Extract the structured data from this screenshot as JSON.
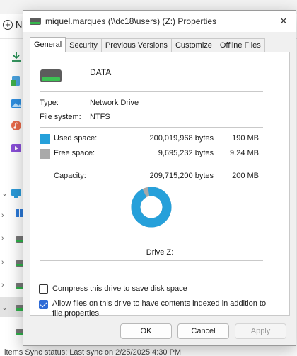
{
  "background": {
    "new_label": "N",
    "status_text": "items     Sync status:  Last sync on 2/25/2025 4:30 PM"
  },
  "dialog": {
    "title": "miquel.marques (\\\\dc18\\users) (Z:) Properties",
    "close_glyph": "✕",
    "tabs": [
      "General",
      "Security",
      "Previous Versions",
      "Customize",
      "Offline Files"
    ],
    "active_tab": "General",
    "drive_label": "DATA",
    "type_label": "Type:",
    "type_value": "Network Drive",
    "fs_label": "File system:",
    "fs_value": "NTFS",
    "used": {
      "label": "Used space:",
      "bytes": "200,019,968 bytes",
      "human": "190 MB",
      "color": "#26a0da"
    },
    "free": {
      "label": "Free space:",
      "bytes": "9,695,232 bytes",
      "human": "9.24 MB",
      "color": "#a9a9a9"
    },
    "capacity": {
      "label": "Capacity:",
      "bytes": "209,715,200 bytes",
      "human": "200 MB"
    },
    "used_fraction": 0.9538,
    "drive_caption": "Drive Z:",
    "compress_label": "Compress this drive to save disk space",
    "compress_checked": false,
    "index_label_line1": "Allow files on this drive to have contents indexed in addition to",
    "index_label_line2": "file properties",
    "index_checked": true,
    "buttons": {
      "ok": "OK",
      "cancel": "Cancel",
      "apply": "Apply"
    }
  }
}
